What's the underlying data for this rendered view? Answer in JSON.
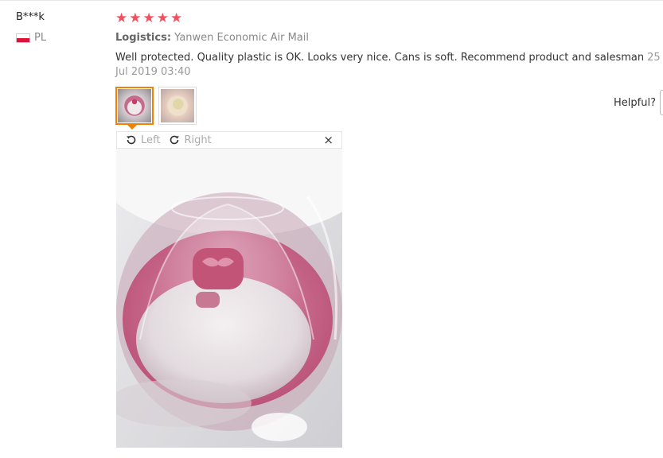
{
  "review": {
    "user": "B***k",
    "country_code": "PL",
    "rating": 5,
    "stars": [
      "★",
      "★",
      "★",
      "★",
      "★"
    ],
    "logistics_label": "Logistics:",
    "logistics_value": "Yanwen Economic Air Mail",
    "text": "Well protected. Quality plastic is OK. Looks very nice. Cans is soft. Recommend product and salesman",
    "date": "25 Jul 2019 03:40",
    "helpful_label": "Helpful?"
  },
  "viewer": {
    "rotate_left_label": "Left",
    "rotate_right_label": "Right",
    "close_symbol": "×"
  },
  "thumbnails": [
    "thumb-1",
    "thumb-2"
  ],
  "colors": {
    "star": "#f0505f",
    "accent": "#f08200",
    "muted": "#888888"
  }
}
